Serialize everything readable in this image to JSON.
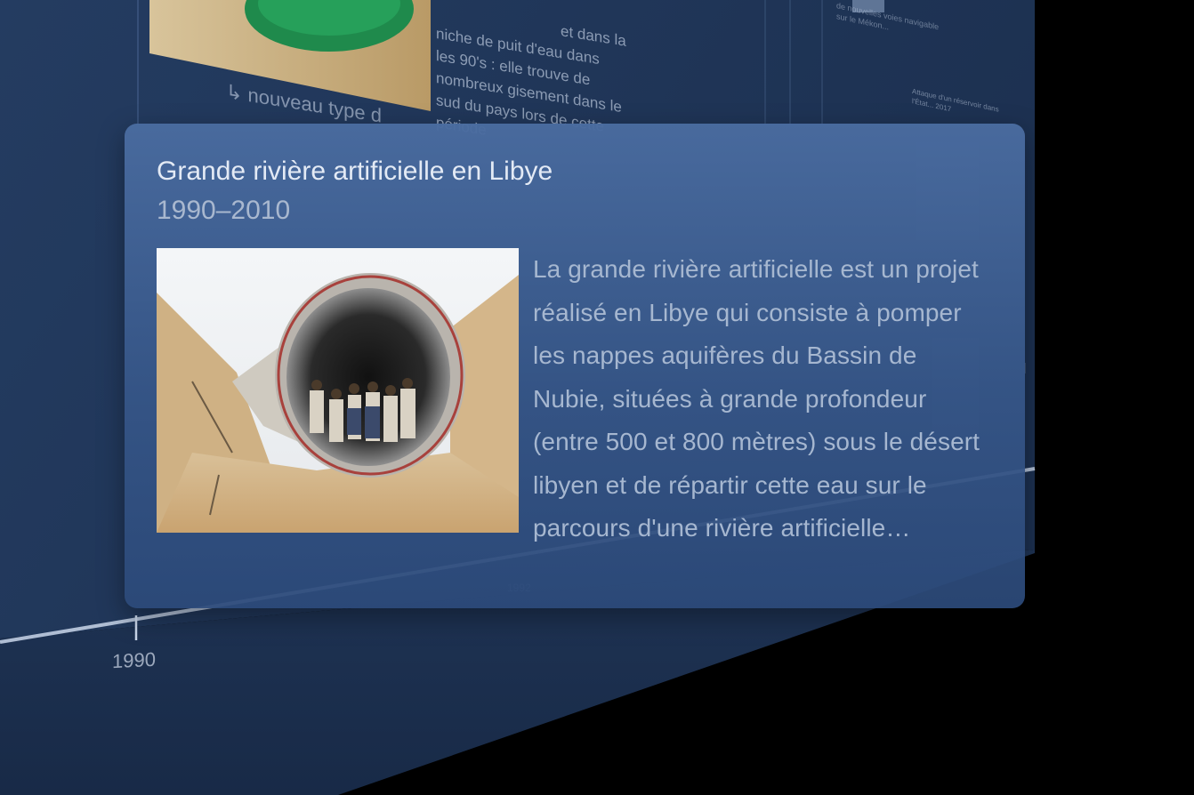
{
  "background": {
    "article_text_lines": [
      "et dans la",
      "niche de puit d'eau dans",
      "les 90's : elle trouve de",
      "nombreux gisement dans le",
      "sud du pays lors de cette",
      "période"
    ],
    "caption": "↳ nouveau type d",
    "small_text_1": "de nouvelles voies navigable sur le Mékon...",
    "small_text_2": "Attaque d'un réservoir dans l'État... 2017",
    "timeline_tick_label": "1990",
    "timeline_tick_label_faint": "1992"
  },
  "card": {
    "title": "Grande rivière artificielle en Libye",
    "dates": "1990–2010",
    "description": "La grande rivière artificielle est un projet réalisé en Libye qui consiste à pomper les nappes aquifères du Bassin de Nubie, situées à grande profondeur (entre 500 et 800 mètres) sous le désert libyen et de répartir cette eau sur le parcours d'une rivière artificielle constituée d'une canalisation"
  },
  "colors": {
    "card_bg": "#4a6ca0",
    "wall_bg": "#22385c",
    "timeline_line": "#c9d6ea"
  }
}
